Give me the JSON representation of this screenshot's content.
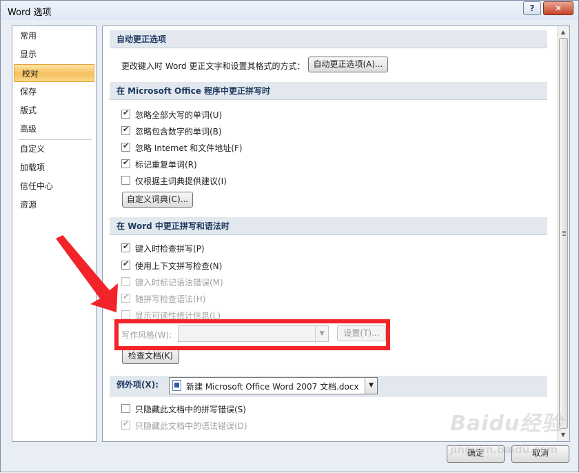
{
  "window": {
    "title": "Word 选项",
    "help": "?",
    "close": "✕"
  },
  "nav": {
    "items": [
      {
        "label": "常用"
      },
      {
        "label": "显示"
      },
      {
        "label": "校对",
        "selected": true
      },
      {
        "label": "保存"
      },
      {
        "label": "版式"
      },
      {
        "label": "高级"
      },
      {
        "label": "自定义"
      },
      {
        "label": "加载项"
      },
      {
        "label": "信任中心"
      },
      {
        "label": "资源"
      }
    ]
  },
  "autocorrect": {
    "header": "自动更正选项",
    "description": "更改键入时 Word 更正文字和设置其格式的方式：",
    "button": "自动更正选项(A)..."
  },
  "office_spelling": {
    "header": "在 Microsoft Office 程序中更正拼写时",
    "options": [
      {
        "label": "忽略全部大写的单词(U)",
        "checked": true
      },
      {
        "label": "忽略包含数字的单词(B)",
        "checked": true
      },
      {
        "label": "忽略 Internet 和文件地址(F)",
        "checked": true
      },
      {
        "label": "标记重复单词(R)",
        "checked": true
      },
      {
        "label": "仅根据主词典提供建议(I)",
        "checked": false
      }
    ],
    "custom_dictionaries_button": "自定义词典(C)..."
  },
  "word_spelling": {
    "header": "在 Word 中更正拼写和语法时",
    "options": [
      {
        "label": "键入时检查拼写(P)",
        "checked": true,
        "enabled": true
      },
      {
        "label": "使用上下文拼写检查(N)",
        "checked": true,
        "enabled": true
      },
      {
        "label": "键入时标记语法错误(M)",
        "checked": false,
        "enabled": false
      },
      {
        "label": "随拼写检查语法(H)",
        "checked": true,
        "enabled": false
      },
      {
        "label": "显示可读性统计信息(L)",
        "checked": false,
        "enabled": false
      }
    ],
    "writing_style_label": "写作风格(W):",
    "writing_style_value": "",
    "settings_button": "设置(T)...",
    "recheck_button": "检查文档(K)"
  },
  "exceptions": {
    "label": "例外项(X):",
    "document": "新建 Microsoft Office Word 2007 文档.docx",
    "options": [
      {
        "label": "只隐藏此文档中的拼写错误(S)",
        "checked": false,
        "enabled": true
      },
      {
        "label": "只隐藏此文档中的语法错误(D)",
        "checked": true,
        "enabled": false
      }
    ]
  },
  "footer": {
    "ok": "确定",
    "cancel": "取消"
  },
  "watermark": {
    "logo": "Baidu经验",
    "url": "jingyan.baidu.com"
  },
  "colors": {
    "annotation_red": "#f3232a",
    "selected_nav": "#f7c05c",
    "section_header_bg": "#e3e8ef"
  }
}
